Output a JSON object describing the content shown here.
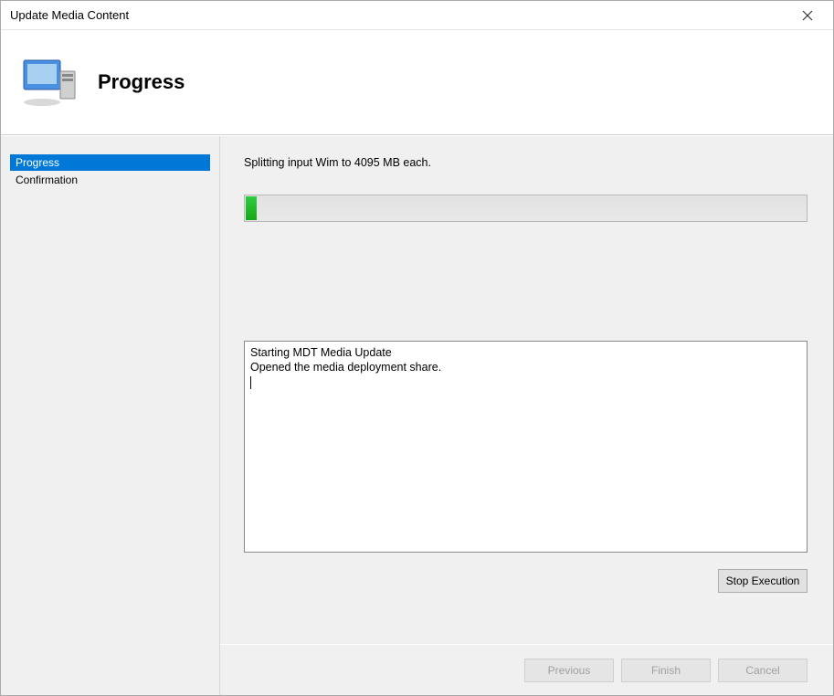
{
  "titlebar": {
    "title": "Update Media Content"
  },
  "header": {
    "title": "Progress"
  },
  "sidebar": {
    "items": [
      {
        "label": "Progress",
        "active": true
      },
      {
        "label": "Confirmation",
        "active": false
      }
    ]
  },
  "main": {
    "status_text": "Splitting input Wim to 4095 MB each.",
    "progress_percent": 2,
    "log_text": "Starting MDT Media Update\nOpened the media deployment share.",
    "stop_label": "Stop Execution"
  },
  "footer": {
    "previous_label": "Previous",
    "finish_label": "Finish",
    "cancel_label": "Cancel"
  }
}
